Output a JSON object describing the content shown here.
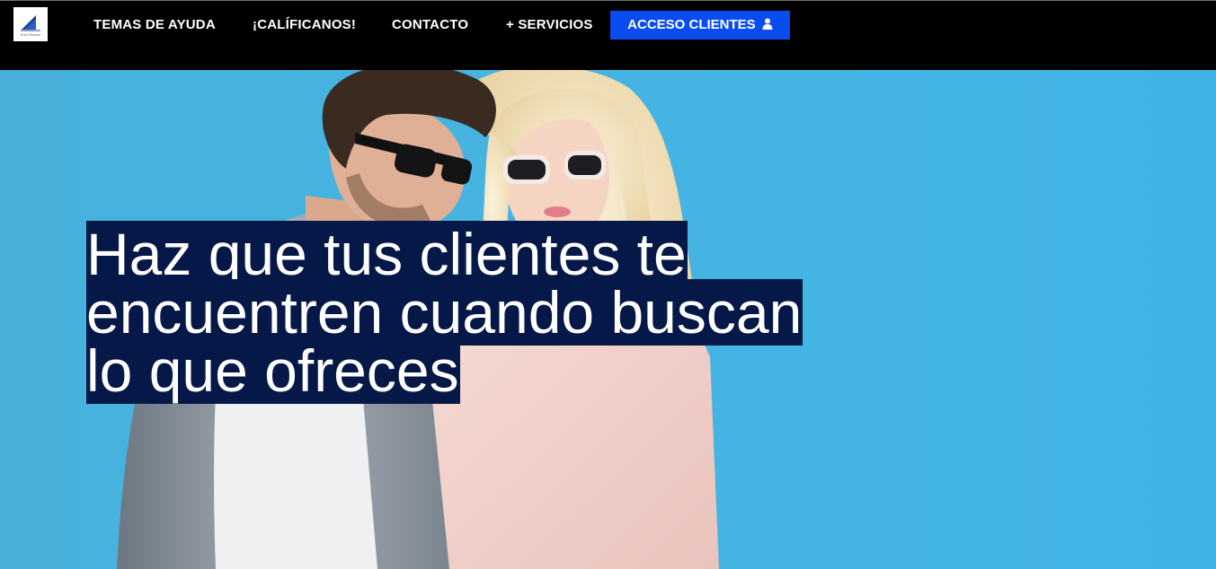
{
  "header": {
    "logo_text": "Enid Service",
    "nav": [
      {
        "label": "TEMAS DE AYUDA"
      },
      {
        "label": "¡CALÍFICANOS!"
      },
      {
        "label": "CONTACTO"
      },
      {
        "label": "+ SERVICIOS"
      }
    ],
    "cta_label": "ACCESO CLIENTES",
    "cta_icon": "user-icon",
    "cta_color": "#0a4cf0"
  },
  "hero": {
    "headline_lines": [
      "Haz que tus clientes te",
      "encuentren cuando buscan",
      "lo que ofreces"
    ],
    "highlight_color": "#061848",
    "background_color": "#4ab3de"
  }
}
